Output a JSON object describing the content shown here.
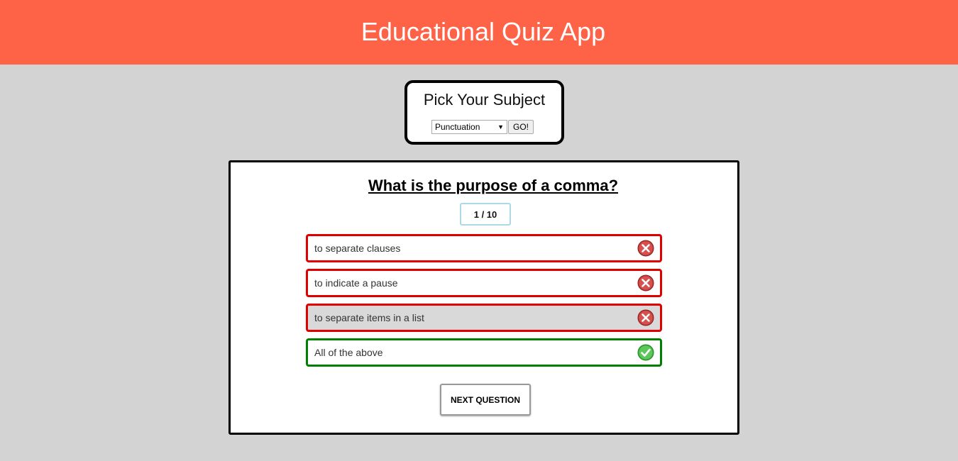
{
  "header": {
    "title": "Educational Quiz App"
  },
  "subject_picker": {
    "title": "Pick Your Subject",
    "selected_subject": "Punctuation",
    "go_label": "GO!"
  },
  "quiz": {
    "question": "What is the purpose of a comma?",
    "progress": "1 / 10",
    "answers": [
      {
        "text": "to separate clauses",
        "status": "incorrect",
        "icon": "x-icon"
      },
      {
        "text": "to indicate a pause",
        "status": "incorrect",
        "icon": "x-icon"
      },
      {
        "text": "to separate items in a list",
        "status": "incorrect",
        "icon": "x-icon"
      },
      {
        "text": "All of the above",
        "status": "correct",
        "icon": "check-icon"
      }
    ],
    "next_label": "NEXT QUESTION"
  },
  "colors": {
    "header_bg": "#ff6347",
    "page_bg": "#d3d3d3",
    "incorrect_border": "#e00000",
    "correct_border": "#008000",
    "progress_border": "#add8e6"
  }
}
